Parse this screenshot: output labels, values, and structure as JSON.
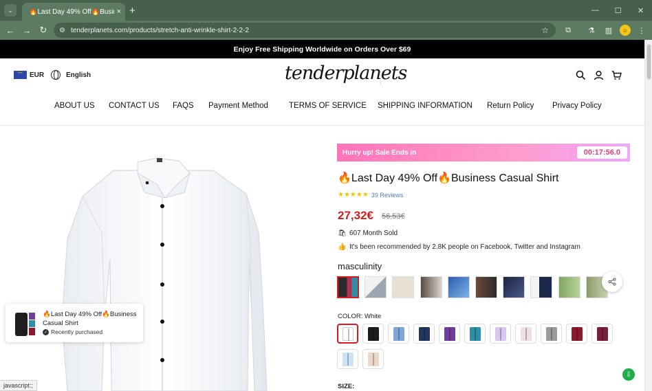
{
  "browser": {
    "tab_title": "🔥Last Day 49% Off🔥Business",
    "tab_close": "×",
    "new_tab": "+",
    "url": "tenderplanets.com/products/stretch-anti-wrinkle-shirt-2-2-2",
    "status_text": "javascript:;"
  },
  "site": {
    "announcement": "Enjoy Free Shipping Worldwide on Orders Over $69",
    "currency": "EUR",
    "language": "English",
    "logo": "tenderplanets",
    "nav": [
      "ABOUT US",
      "CONTACT US",
      "FAQS",
      "Payment Method",
      "TERMS OF SERVICE",
      "SHIPPING INFORMATION",
      "Return Policy",
      "Privacy Policy"
    ]
  },
  "product": {
    "sale_label": "Hurry up! Sale Ends in",
    "timer": "00:17:56.0",
    "title": "🔥Last Day 49% Off🔥Business Casual Shirt",
    "rating": 5,
    "stars": "★★★★★",
    "reviews": "39 Reviews",
    "price": "27,32€",
    "compare_price": "56,53€",
    "sold": "607 Month Sold",
    "recommendation": "It's been recommended by 2.8K people on Facebook, Twitter and Instagram",
    "style_label": "masculinity",
    "color_label": "COLOR: White",
    "size_label": "SIZE:",
    "swatch_colors": [
      "#ffffff",
      "#1c1c1c",
      "#7ea6d6",
      "#25365c",
      "#6d3f9a",
      "#2e8fa8",
      "#d8c8f0",
      "#f1dde8",
      "#9a9a9a",
      "#8a1a2c",
      "#7a1e3a",
      "#cfe3f6",
      "#ead8c8"
    ]
  },
  "popup": {
    "title": "🔥Last Day 49% Off🔥Business Casual Shirt",
    "status": "Recently purchased"
  },
  "colors": {
    "accent": "#d81b1b",
    "sale_gradient_start": "#ff74b8",
    "chrome": "#5d7a62"
  }
}
